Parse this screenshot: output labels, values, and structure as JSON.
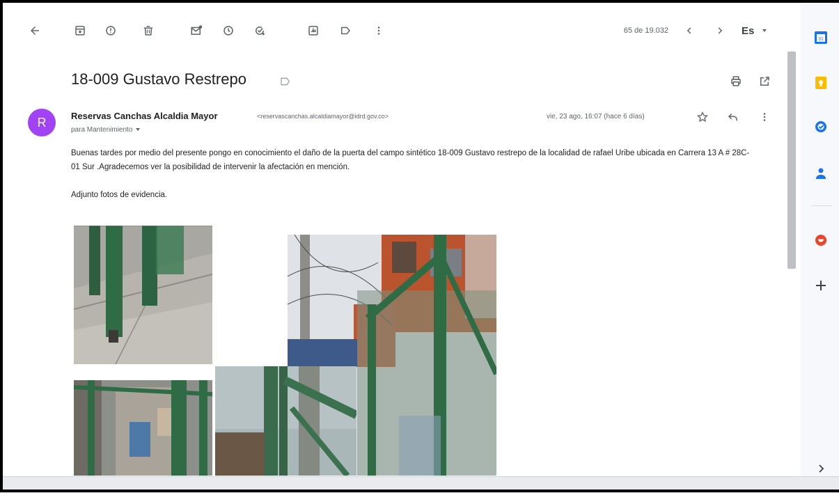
{
  "toolbar": {
    "back_icon": "arrow-left-icon",
    "archive_icon": "archive-icon",
    "report_spam_icon": "report-icon",
    "delete_icon": "trash-icon",
    "mark_unread_icon": "mail-unread-icon",
    "snooze_icon": "clock-icon",
    "add_task_icon": "add-task-icon",
    "move_to_icon": "move-icon",
    "labels_icon": "label-icon",
    "more_icon": "more-vertical-icon",
    "pager_count": "65 de 19.032",
    "language": "Es"
  },
  "message": {
    "subject": "18-009 Gustavo Restrepo",
    "avatar_letter": "R",
    "avatar_color": "#a142f4",
    "sender_name": "Reservas Canchas Alcaldia Mayor",
    "sender_email": "<reservascanchas.alcaldiamayor@idrd.gov.co>",
    "recipient": "para Mantenimiento",
    "date": "vie, 23 ago, 16:07 (hace 6 días)",
    "body": [
      "Buenas tardes  por medio del presente pongo en  conocimiento el daño de la puerta del campo sintético 18-009 Gustavo restrepo de la localidad de rafael Uribe ubicada en  Carrera 13 A # 28C- 01 Sur .Agradecemos  ver la posibilidad de intervenir la afectación en mención.",
      "Adjunto fotos de evidencia."
    ]
  },
  "side_panel": {
    "apps": [
      "calendar-icon",
      "keep-icon",
      "tasks-icon",
      "contacts-icon",
      "addon-icon",
      "add-icon",
      "chevron-right-icon"
    ],
    "colors": {
      "calendar": "#1a73e8",
      "keep": "#fbbc04",
      "tasks": "#1a73e8",
      "contacts": "#1a73e8",
      "addon": "#e8472c"
    }
  }
}
